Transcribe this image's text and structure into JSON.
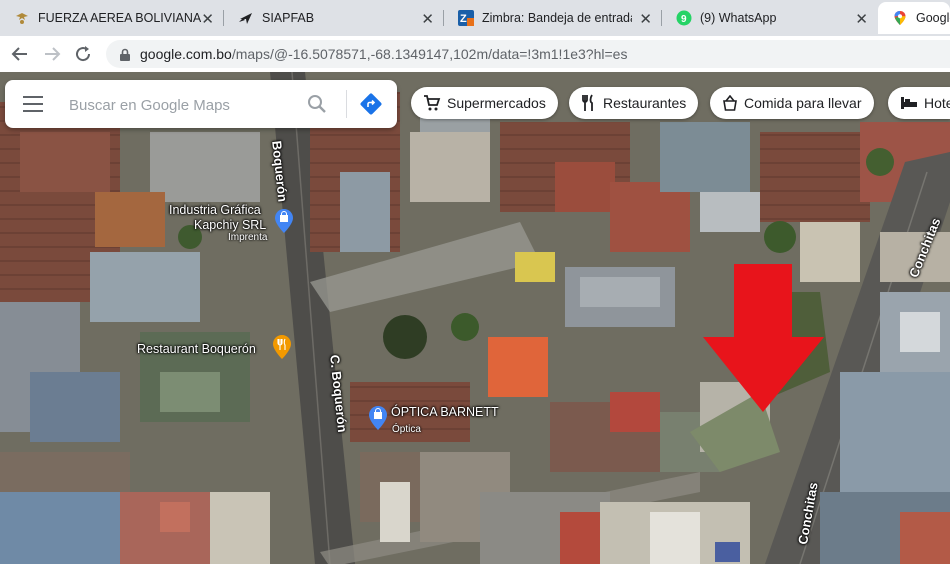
{
  "browser": {
    "tabs": [
      {
        "title": "FUERZA AEREA BOLIVIANA",
        "icon": "eagle-favicon"
      },
      {
        "title": "SIAPFAB",
        "icon": "airplane-favicon"
      },
      {
        "title": "Zimbra: Bandeja de entrada (",
        "icon": "zimbra-favicon"
      },
      {
        "title": "(9) WhatsApp",
        "icon": "whatsapp-favicon",
        "badge": "9"
      },
      {
        "title": "Google",
        "icon": "google-maps-favicon"
      }
    ],
    "url_host": "google.com.bo",
    "url_path": "/maps/@-16.5078571,-68.1349147,102m/data=!3m1!1e3?hl=es"
  },
  "maps": {
    "search_placeholder": "Buscar en Google Maps",
    "chips": [
      {
        "label": "Supermercados",
        "icon": "cart-icon"
      },
      {
        "label": "Restaurantes",
        "icon": "fork-knife-icon"
      },
      {
        "label": "Comida para llevar",
        "icon": "takeout-icon"
      },
      {
        "label": "Hoteles",
        "icon": "bed-icon"
      }
    ],
    "places": [
      {
        "name_line1": "Industria Gráfica",
        "name_line2": "Kapchiy SRL",
        "category": "Imprenta",
        "icon": "shopping-bag-pin"
      },
      {
        "name": "Restaurant Boquerón",
        "icon": "restaurant-pin"
      },
      {
        "name": "ÓPTICA BARNETT",
        "category": "Óptica",
        "icon": "shopping-bag-pin"
      }
    ],
    "streets": {
      "boqueron_top": "Boquerón",
      "boqueron": "C. Boquerón",
      "conchitas_top": "Conchitas",
      "conchitas_bottom": "Conchitas"
    },
    "annotation": "red-arrow-pointing-down",
    "colors": {
      "arrow": "#e8141b",
      "accent": "#1a73e8",
      "restaurant_pin": "#f29900",
      "shop_pin": "#4285f4"
    }
  }
}
